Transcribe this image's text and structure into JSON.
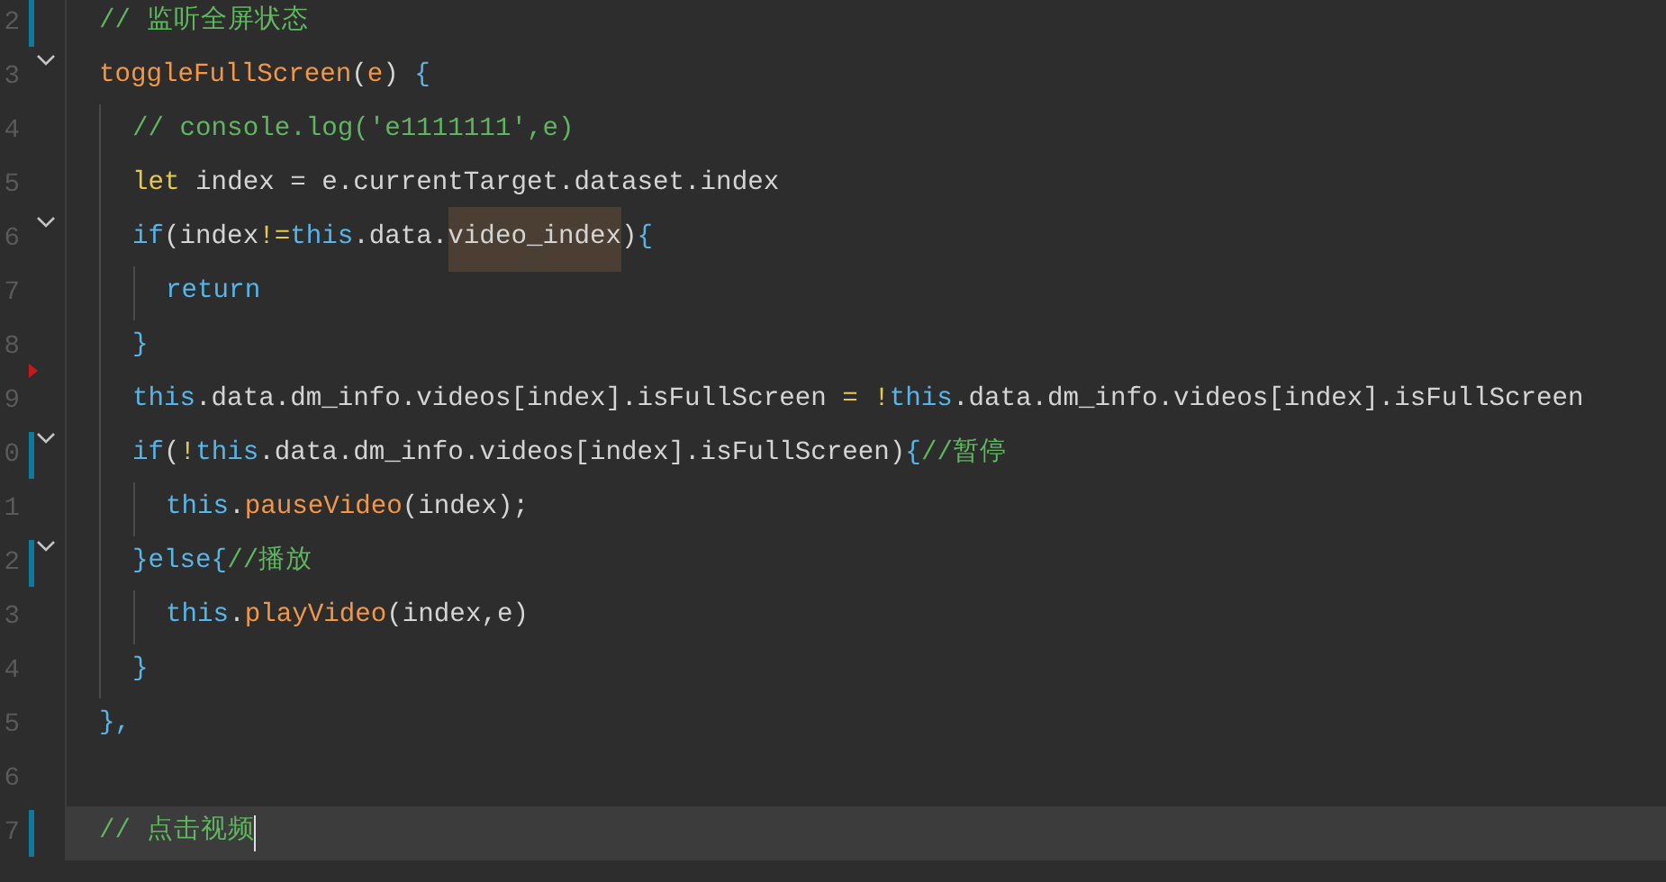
{
  "lines": [
    {
      "number": "2",
      "fold": false,
      "modified": true,
      "breakpoint": false,
      "current": false,
      "tokens": [
        {
          "text": "// 监听全屏状态",
          "kind": "comment"
        }
      ]
    },
    {
      "number": "3",
      "fold": true,
      "modified": false,
      "breakpoint": false,
      "current": false,
      "tokens": [
        {
          "text": "toggleFullScreen",
          "kind": "function"
        },
        {
          "text": "(",
          "kind": "plain"
        },
        {
          "text": "e",
          "kind": "param"
        },
        {
          "text": ") ",
          "kind": "plain"
        },
        {
          "text": "{",
          "kind": "brace"
        }
      ]
    },
    {
      "number": "4",
      "fold": false,
      "modified": false,
      "breakpoint": false,
      "current": false,
      "tokens": [
        {
          "text": "  // console.log('e1111111',e)",
          "kind": "comment"
        }
      ]
    },
    {
      "number": "5",
      "fold": false,
      "modified": false,
      "breakpoint": false,
      "current": false,
      "tokens": [
        {
          "text": "  let",
          "kind": "keyword"
        },
        {
          "text": " index = e.currentTarget.dataset.index",
          "kind": "plain"
        }
      ]
    },
    {
      "number": "6",
      "fold": true,
      "modified": false,
      "breakpoint": false,
      "current": false,
      "tokens": [
        {
          "text": "  if",
          "kind": "this"
        },
        {
          "text": "(index",
          "kind": "plain"
        },
        {
          "text": "!=",
          "kind": "keyword"
        },
        {
          "text": "this",
          "kind": "this"
        },
        {
          "text": ".data.",
          "kind": "plain"
        },
        {
          "text": "video_index",
          "kind": "highlight"
        },
        {
          "text": ")",
          "kind": "plain"
        },
        {
          "text": "{",
          "kind": "brace"
        }
      ]
    },
    {
      "number": "7",
      "fold": false,
      "modified": false,
      "breakpoint": false,
      "current": false,
      "tokens": [
        {
          "text": "    return",
          "kind": "this"
        }
      ]
    },
    {
      "number": "8",
      "fold": false,
      "modified": false,
      "breakpoint": false,
      "current": false,
      "tokens": [
        {
          "text": "  }",
          "kind": "brace"
        }
      ]
    },
    {
      "number": "9",
      "fold": false,
      "modified": false,
      "breakpoint": true,
      "current": false,
      "tokens": [
        {
          "text": "  this",
          "kind": "this"
        },
        {
          "text": ".data.dm_info.videos[index].isFullScreen ",
          "kind": "plain"
        },
        {
          "text": "= !",
          "kind": "keyword"
        },
        {
          "text": "this",
          "kind": "this"
        },
        {
          "text": ".data.dm_info.videos[index].isFullScreen",
          "kind": "plain"
        }
      ]
    },
    {
      "number": "0",
      "fold": true,
      "modified": true,
      "breakpoint": false,
      "current": false,
      "tokens": [
        {
          "text": "  if",
          "kind": "this"
        },
        {
          "text": "(",
          "kind": "plain"
        },
        {
          "text": "!",
          "kind": "keyword"
        },
        {
          "text": "this",
          "kind": "this"
        },
        {
          "text": ".data.dm_info.videos[index].isFullScreen)",
          "kind": "plain"
        },
        {
          "text": "{",
          "kind": "brace"
        },
        {
          "text": "//暂停",
          "kind": "comment"
        }
      ]
    },
    {
      "number": "1",
      "fold": false,
      "modified": false,
      "breakpoint": false,
      "current": false,
      "tokens": [
        {
          "text": "    this",
          "kind": "this"
        },
        {
          "text": ".",
          "kind": "plain"
        },
        {
          "text": "pauseVideo",
          "kind": "function"
        },
        {
          "text": "(index);",
          "kind": "plain"
        }
      ]
    },
    {
      "number": "2",
      "fold": true,
      "modified": true,
      "breakpoint": false,
      "current": false,
      "tokens": [
        {
          "text": "  }else{",
          "kind": "brace"
        },
        {
          "text": "//播放",
          "kind": "comment"
        }
      ]
    },
    {
      "number": "3",
      "fold": false,
      "modified": false,
      "breakpoint": false,
      "current": false,
      "tokens": [
        {
          "text": "    this",
          "kind": "this"
        },
        {
          "text": ".",
          "kind": "plain"
        },
        {
          "text": "playVideo",
          "kind": "function"
        },
        {
          "text": "(index,e)",
          "kind": "plain"
        }
      ]
    },
    {
      "number": "4",
      "fold": false,
      "modified": false,
      "breakpoint": false,
      "current": false,
      "tokens": [
        {
          "text": "  }",
          "kind": "brace"
        }
      ]
    },
    {
      "number": "5",
      "fold": false,
      "modified": false,
      "breakpoint": false,
      "current": false,
      "tokens": [
        {
          "text": "},",
          "kind": "brace"
        }
      ]
    },
    {
      "number": "6",
      "fold": false,
      "modified": false,
      "breakpoint": false,
      "current": false
    },
    {
      "number": "7",
      "fold": false,
      "modified": true,
      "breakpoint": false,
      "current": true,
      "tokens": [
        {
          "text": "// 点击视频",
          "kind": "comment"
        }
      ]
    }
  ]
}
